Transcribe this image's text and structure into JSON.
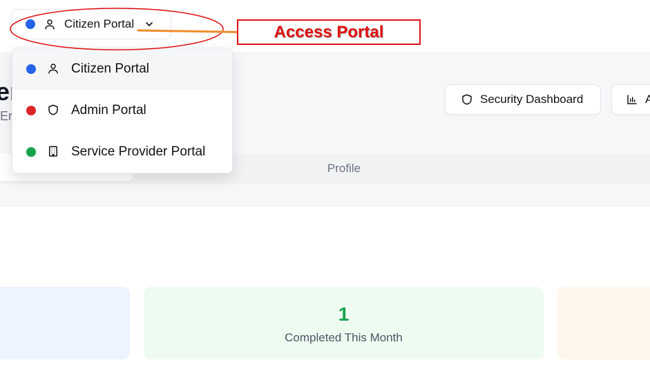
{
  "header": {
    "portal_switcher": {
      "label": "Citizen Portal",
      "status_color": "#2563eb"
    }
  },
  "banner": {
    "title_partial": "er",
    "subtitle_partial": "Er",
    "buttons": {
      "security_label": "Security Dashboard",
      "analytics_label": "A"
    }
  },
  "tabs": {
    "profile_label": "Profile"
  },
  "stats": {
    "completed": {
      "value": "1",
      "label": "Completed This Month"
    }
  },
  "portal_menu": {
    "items": [
      {
        "label": "Citizen Portal",
        "icon": "user-icon",
        "color": "#2563eb"
      },
      {
        "label": "Admin Portal",
        "icon": "shield-icon",
        "color": "#dc2626"
      },
      {
        "label": "Service Provider Portal",
        "icon": "building-icon",
        "color": "#16a34a"
      }
    ]
  },
  "annotation": {
    "callout_text": "Access Portal",
    "color": "#e01010",
    "arrow_color": "#f08c2a"
  }
}
